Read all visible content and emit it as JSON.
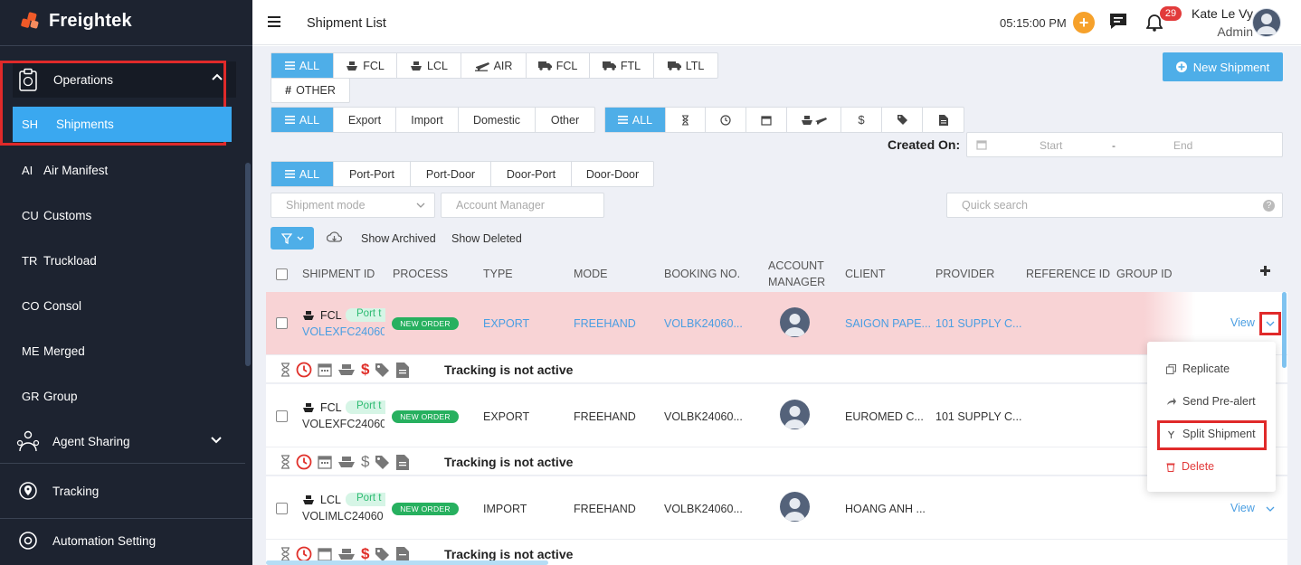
{
  "app": {
    "name": "Freightek",
    "brand_color": "#f05a28",
    "sidebar_bg": "#1d2330",
    "accent": "#4eaee8"
  },
  "sidebar": {
    "parent": {
      "label": "Operations",
      "icon": "clipboard-icon"
    },
    "items": [
      {
        "abbr": "SH",
        "label": "Shipments",
        "active": true
      },
      {
        "abbr": "AI",
        "label": "Air Manifest"
      },
      {
        "abbr": "CU",
        "label": "Customs"
      },
      {
        "abbr": "TR",
        "label": "Truckload"
      },
      {
        "abbr": "CO",
        "label": "Consol"
      },
      {
        "abbr": "ME",
        "label": "Merged"
      },
      {
        "abbr": "GR",
        "label": "Group"
      }
    ],
    "agent_sharing": "Agent Sharing",
    "tracking": "Tracking",
    "automation": "Automation Setting"
  },
  "header": {
    "title": "Shipment List",
    "time": "05:15:00 PM",
    "notifications": "29",
    "user_name": "Kate Le Vy",
    "user_role": "Admin"
  },
  "filters": {
    "modes": [
      "ALL",
      "FCL",
      "LCL",
      "AIR",
      "FCL",
      "FTL",
      "LTL"
    ],
    "other": "OTHER",
    "types": [
      "ALL",
      "Export",
      "Import",
      "Domestic",
      "Other"
    ],
    "status_all": "ALL",
    "routes": [
      "ALL",
      "Port-Port",
      "Port-Door",
      "Door-Port",
      "Door-Door"
    ],
    "created_on_label": "Created On:",
    "date_start": "Start",
    "date_sep": "-",
    "date_end": "End",
    "shipment_mode_placeholder": "Shipment mode",
    "account_manager_placeholder": "Account Manager",
    "quick_search_placeholder": "Quick search",
    "show_archived": "Show Archived",
    "show_deleted": "Show Deleted",
    "new_shipment": "New Shipment"
  },
  "table": {
    "columns": [
      "SHIPMENT ID",
      "PROCESS",
      "TYPE",
      "MODE",
      "BOOKING NO.",
      "ACCOUNT",
      "MANAGER",
      "CLIENT",
      "PROVIDER",
      "REFERENCE ID",
      "GROUP ID"
    ],
    "rows": [
      {
        "mode": "FCL",
        "tag": "Port t",
        "id": "VOLEXFC24060",
        "process": "NEW ORDER",
        "type": "EXPORT",
        "shipmode": "FREEHAND",
        "booking": "VOLBK24060...",
        "client": "SAIGON PAPE...",
        "provider": "101 SUPPLY C...",
        "view": "View",
        "tracking": "Tracking is not active"
      },
      {
        "mode": "FCL",
        "tag": "Port t",
        "id": "VOLEXFC24060",
        "process": "NEW ORDER",
        "type": "EXPORT",
        "shipmode": "FREEHAND",
        "booking": "VOLBK24060...",
        "client": "EUROMED C...",
        "provider": "101 SUPPLY C...",
        "tracking": "Tracking is not active"
      },
      {
        "mode": "LCL",
        "tag": "Port t",
        "id": "VOLIMLC24060",
        "process": "NEW ORDER",
        "type": "IMPORT",
        "shipmode": "FREEHAND",
        "booking": "VOLBK24060...",
        "client": "HOANG ANH ...",
        "provider": "",
        "view": "View",
        "tracking": "Tracking is not active"
      }
    ]
  },
  "menu": {
    "replicate": "Replicate",
    "pre_alert": "Send Pre-alert",
    "split": "Split Shipment",
    "delete": "Delete"
  }
}
